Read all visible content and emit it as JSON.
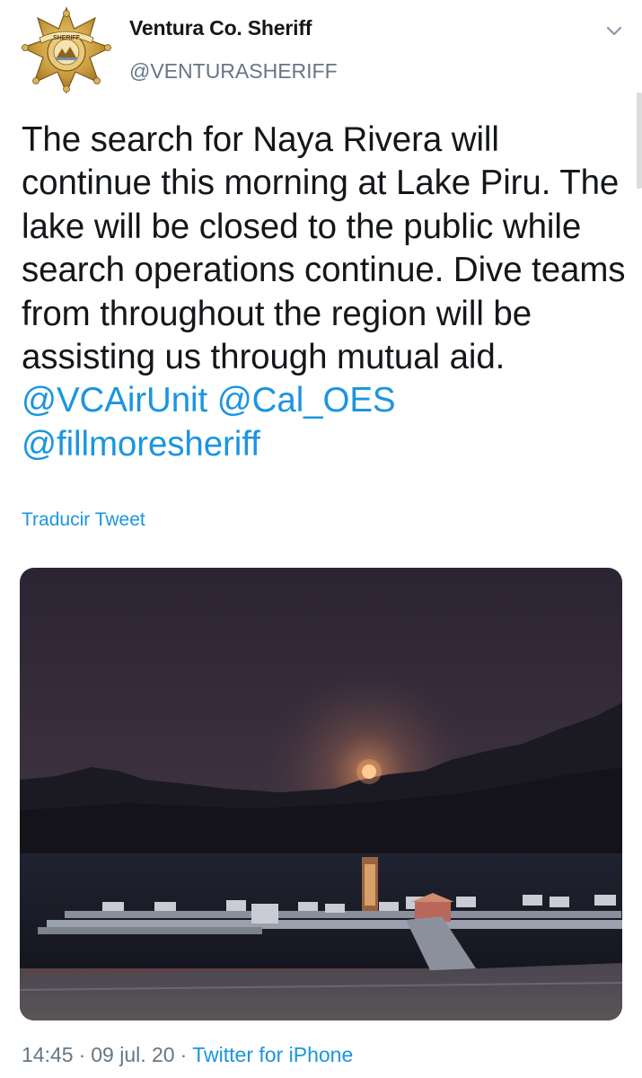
{
  "author": {
    "name": "Ventura Co. Sheriff",
    "handle": "@VENTURASHERIFF",
    "avatar_icon": "sheriff-star-badge-icon",
    "badge_text_top": "SHERIFF",
    "badge_text_ring": "VENTURA COUNTY"
  },
  "menu_icon": "chevron-down-icon",
  "tweet": {
    "text_plain": "The search for Naya Rivera will continue this morning at Lake Piru. The lake will be closed to the public while search operations continue. Dive teams from throughout the region will be assisting us through mutual aid.",
    "mentions": [
      "@VCAirUnit",
      "@Cal_OES",
      "@fillmoresheriff"
    ]
  },
  "translate_label": "Traducir Tweet",
  "meta": {
    "time": "14:45",
    "date": "09 jul. 20",
    "separator": "·",
    "source": "Twitter for iPhone"
  },
  "colors": {
    "link": "#1b95e0",
    "secondary_text": "#657786",
    "primary_text": "#14171a",
    "badge_gold": "#c79a3b"
  }
}
